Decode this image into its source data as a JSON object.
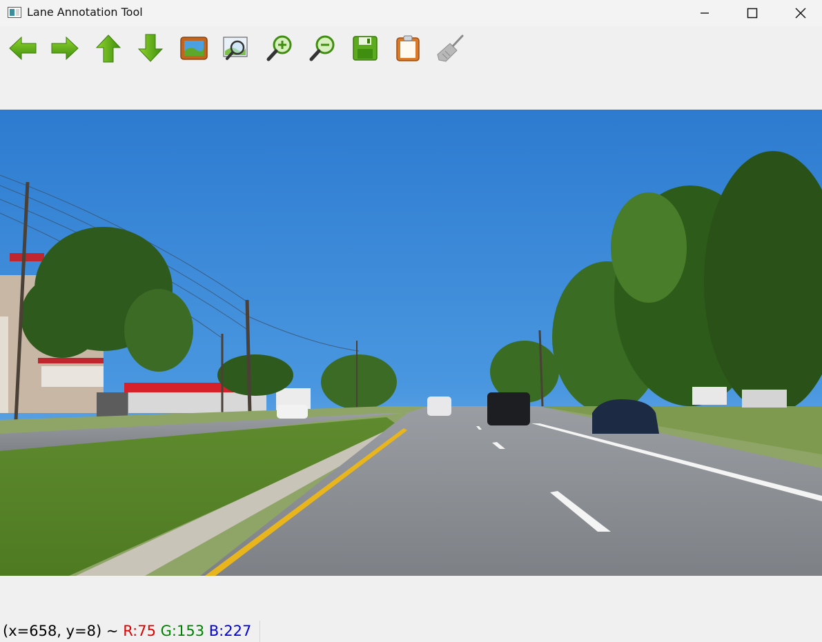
{
  "window": {
    "title": "Lane Annotation Tool",
    "minimize_icon": "minimize-icon",
    "maximize_icon": "maximize-icon",
    "close_icon": "close-icon"
  },
  "toolbar": [
    {
      "name": "prev-image-button",
      "icon": "arrow-left-icon"
    },
    {
      "name": "next-image-button",
      "icon": "arrow-right-icon"
    },
    {
      "name": "move-up-button",
      "icon": "arrow-up-icon"
    },
    {
      "name": "move-down-button",
      "icon": "arrow-down-icon"
    },
    {
      "name": "open-image-button",
      "icon": "image-icon"
    },
    {
      "name": "fit-view-button",
      "icon": "zoom-fit-icon"
    },
    {
      "name": "zoom-in-button",
      "icon": "zoom-in-icon"
    },
    {
      "name": "zoom-out-button",
      "icon": "zoom-out-icon"
    },
    {
      "name": "save-button",
      "icon": "save-icon"
    },
    {
      "name": "paste-button",
      "icon": "clipboard-icon"
    },
    {
      "name": "clear-button",
      "icon": "broom-icon"
    }
  ],
  "image": {
    "description_icon": "road-scene-image"
  },
  "status": {
    "coords": "(x=658, y=8) ~ ",
    "r": "R:75",
    "g": "G:153",
    "b": "B:227"
  },
  "colors": {
    "r": "#e00000",
    "g": "#008000",
    "b": "#0000e0"
  }
}
